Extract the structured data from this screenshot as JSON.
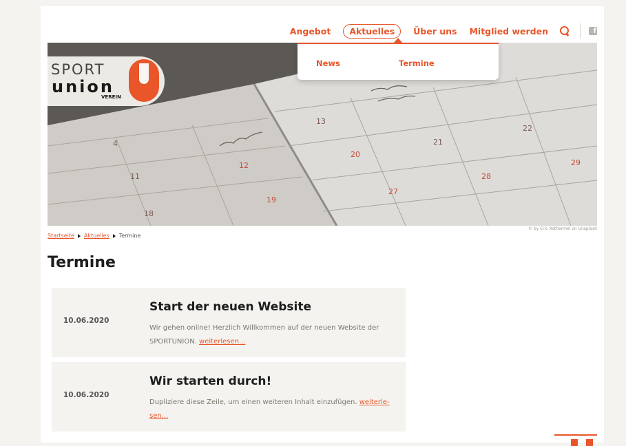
{
  "nav": {
    "items": [
      {
        "label": "Angebot"
      },
      {
        "label": "Aktuelles"
      },
      {
        "label": "Über uns"
      },
      {
        "label": "Mitglied werden"
      }
    ],
    "search_icon": "search-icon",
    "facebook_icon": "facebook-icon",
    "facebook_glyph": "f"
  },
  "dropdown": {
    "items": [
      {
        "label": "News"
      },
      {
        "label": "Termine"
      }
    ]
  },
  "logo": {
    "line1": "SPORT",
    "line2": "union",
    "line3": "VEREIN"
  },
  "hero": {
    "credit": "© by Eric Rothermel on Unsplash",
    "calendar_numbers": [
      "4",
      "11",
      "18",
      "12",
      "19",
      "13",
      "20",
      "27",
      "21",
      "28",
      "22",
      "29"
    ]
  },
  "breadcrumb": {
    "items": [
      "Startseite",
      "Aktuelles",
      "Termine"
    ]
  },
  "page_title": "Termine",
  "events": [
    {
      "date": "10.06.2020",
      "title": "Start der neuen Website",
      "text": "Wir gehen online! Herzlich Willkommen auf der neuen Website der SPORTUNION.",
      "link": "weiterlesen..."
    },
    {
      "date": "10.06.2020",
      "title": "Wir starten durch!",
      "text": "Dupliziere diese Zeile, um einen weiteren Inhalt einzufügen.",
      "link": "weiterle-sen..."
    }
  ],
  "colors": {
    "accent": "#e8562a",
    "background": "#f4f3ef",
    "card": "#f4f3ef",
    "text": "#1d1d1d"
  }
}
